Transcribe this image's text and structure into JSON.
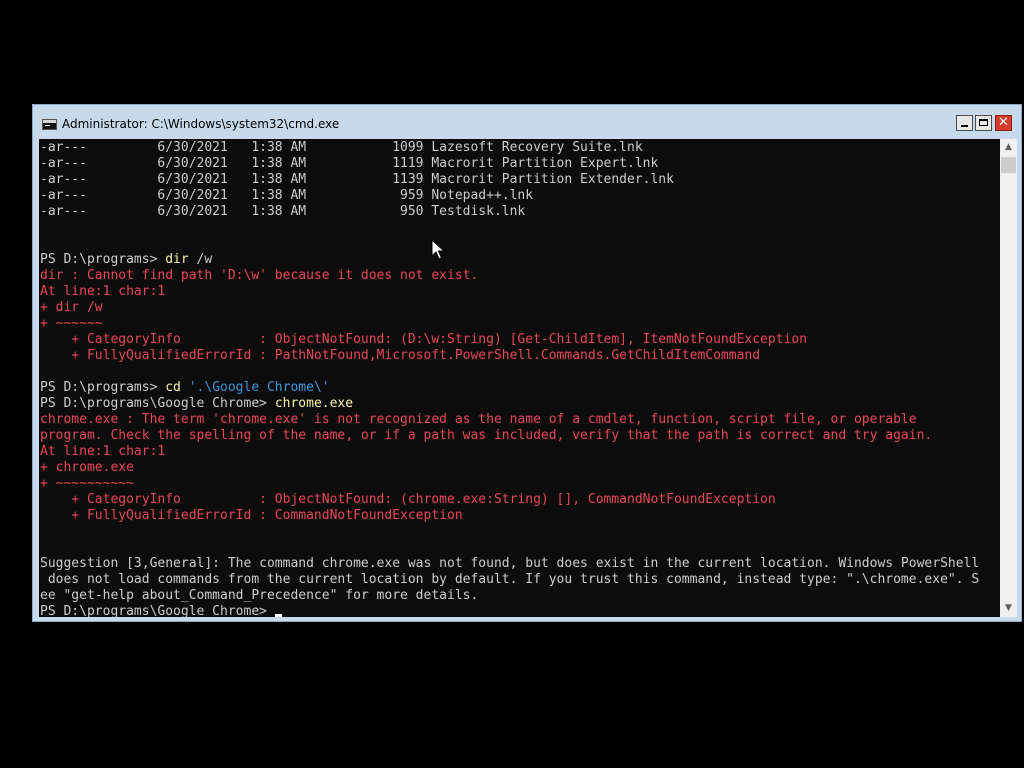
{
  "window": {
    "title": "Administrator: C:\\Windows\\system32\\cmd.exe",
    "close_glyph": "✕"
  },
  "console": {
    "lines": [
      [
        {
          "t": "-ar---         6/30/2021   1:38 AM           1099 Lazesoft Recovery Suite.lnk",
          "c": "norm"
        }
      ],
      [
        {
          "t": "-ar---         6/30/2021   1:38 AM           1119 Macrorit Partition Expert.lnk",
          "c": "norm"
        }
      ],
      [
        {
          "t": "-ar---         6/30/2021   1:38 AM           1139 Macrorit Partition Extender.lnk",
          "c": "norm"
        }
      ],
      [
        {
          "t": "-ar---         6/30/2021   1:38 AM            959 Notepad++.lnk",
          "c": "norm"
        }
      ],
      [
        {
          "t": "-ar---         6/30/2021   1:38 AM            950 Testdisk.lnk",
          "c": "norm"
        }
      ],
      [],
      [],
      [
        {
          "t": "PS D:\\programs> ",
          "c": "norm"
        },
        {
          "t": "dir",
          "c": "cmd"
        },
        {
          "t": " /w",
          "c": "norm"
        }
      ],
      [
        {
          "t": "dir : Cannot find path 'D:\\w' because it does not exist.",
          "c": "err"
        }
      ],
      [
        {
          "t": "At line:1 char:1",
          "c": "err"
        }
      ],
      [
        {
          "t": "+ dir /w",
          "c": "err"
        }
      ],
      [
        {
          "t": "+ ~~~~~~",
          "c": "err"
        }
      ],
      [
        {
          "t": "    + CategoryInfo          : ObjectNotFound: (D:\\w:String) [Get-ChildItem], ItemNotFoundException",
          "c": "err"
        }
      ],
      [
        {
          "t": "    + FullyQualifiedErrorId : PathNotFound,Microsoft.PowerShell.Commands.GetChildItemCommand",
          "c": "err"
        }
      ],
      [],
      [
        {
          "t": "PS D:\\programs> ",
          "c": "norm"
        },
        {
          "t": "cd",
          "c": "cmd"
        },
        {
          "t": " ",
          "c": "norm"
        },
        {
          "t": "'.\\Google Chrome\\'",
          "c": "str"
        }
      ],
      [
        {
          "t": "PS D:\\programs\\Google Chrome> ",
          "c": "norm"
        },
        {
          "t": "chrome.exe",
          "c": "cmd"
        }
      ],
      [
        {
          "t": "chrome.exe : The term 'chrome.exe' is not recognized as the name of a cmdlet, function, script file, or operable",
          "c": "err"
        }
      ],
      [
        {
          "t": "program. Check the spelling of the name, or if a path was included, verify that the path is correct and try again.",
          "c": "err"
        }
      ],
      [
        {
          "t": "At line:1 char:1",
          "c": "err"
        }
      ],
      [
        {
          "t": "+ chrome.exe",
          "c": "err"
        }
      ],
      [
        {
          "t": "+ ~~~~~~~~~~",
          "c": "err"
        }
      ],
      [
        {
          "t": "    + CategoryInfo          : ObjectNotFound: (chrome.exe:String) [], CommandNotFoundException",
          "c": "err"
        }
      ],
      [
        {
          "t": "    + FullyQualifiedErrorId : CommandNotFoundException",
          "c": "err"
        }
      ],
      [],
      [],
      [
        {
          "t": "Suggestion [3,General]: The command chrome.exe was not found, but does exist in the current location. Windows PowerShell",
          "c": "norm"
        }
      ],
      [
        {
          "t": " does not load commands from the current location by default. If you trust this command, instead type: \".\\chrome.exe\". S",
          "c": "norm"
        }
      ],
      [
        {
          "t": "ee \"get-help about_Command_Precedence\" for more details.",
          "c": "norm"
        }
      ],
      [
        {
          "t": "PS D:\\programs\\Google Chrome> ",
          "c": "norm"
        }
      ]
    ]
  },
  "scrollbar": {
    "up_glyph": "▲",
    "down_glyph": "▼"
  },
  "colors": {
    "console_bg": "#0c0c0c",
    "normal_text": "#cccccc",
    "error_text": "#e74856",
    "command_text": "#f9f1a5",
    "string_text": "#3a96dd",
    "titlebar_bg": "#c6daec"
  },
  "icons": {
    "app": "console-app-icon",
    "pointer": "mouse-pointer-icon"
  }
}
